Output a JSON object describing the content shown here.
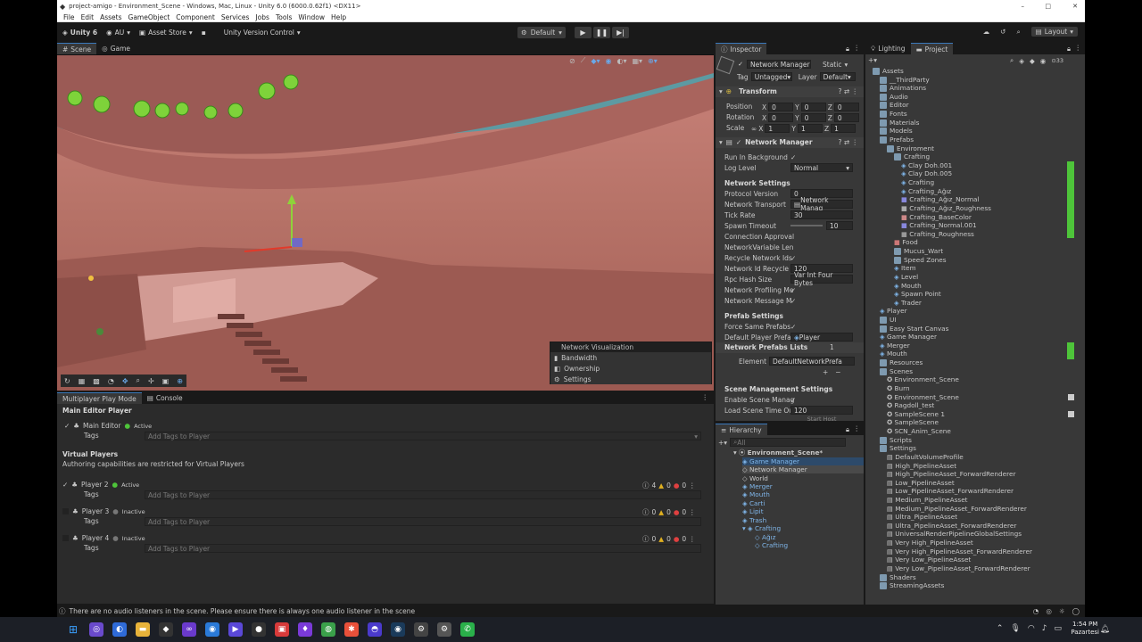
{
  "window": {
    "title": "project-amigo - Environment_Scene - Windows, Mac, Linux - Unity 6.0 (6000.0.62f1) <DX11>",
    "controls": [
      "–",
      "□",
      "✕"
    ]
  },
  "menu": [
    "File",
    "Edit",
    "Assets",
    "GameObject",
    "Component",
    "Services",
    "Jobs",
    "Tools",
    "Window",
    "Help"
  ],
  "toolbar": {
    "unity": "Unity 6",
    "account": "AU",
    "asset_store": "Asset Store",
    "version_control": "Unity Version Control",
    "play_mode": "Default",
    "layout": "Layout"
  },
  "scene_tabs": [
    "Scene",
    "Game"
  ],
  "network_overlay": {
    "title": "Network Visualization",
    "items": [
      "Bandwidth",
      "Ownership",
      "Settings"
    ]
  },
  "mppm": {
    "tabs": [
      "Multiplayer Play Mode",
      "Console"
    ],
    "main_editor": "Main Editor Player",
    "main_label": "Main Editor",
    "active": "Active",
    "inactive": "Inactive",
    "tags": "Tags",
    "tags_placeholder": "Add Tags to Player",
    "virtual": "Virtual Players",
    "virtual_note": "Authoring capabilities are restricted for Virtual Players",
    "players": [
      {
        "name": "Player 2",
        "state": "Active",
        "info": "4",
        "warn": "0",
        "err": "0"
      },
      {
        "name": "Player 3",
        "state": "Inactive",
        "info": "0",
        "warn": "0",
        "err": "0"
      },
      {
        "name": "Player 4",
        "state": "Inactive",
        "info": "0",
        "warn": "0",
        "err": "0"
      }
    ]
  },
  "inspector": {
    "tab": "Inspector",
    "object_name": "Network Manager",
    "static": "Static",
    "tag_label": "Tag",
    "tag": "Untagged",
    "layer_label": "Layer",
    "layer": "Default",
    "transform": "Transform",
    "position": "Position",
    "rotation": "Rotation",
    "scale": "Scale",
    "x": "X",
    "y": "Y",
    "z": "Z",
    "pos": [
      "0",
      "0",
      "0"
    ],
    "rot": [
      "0",
      "0",
      "0"
    ],
    "scl": [
      "1",
      "1",
      "1"
    ],
    "component": "Network Manager",
    "rows": [
      {
        "label": "Run In Background",
        "value": "✓"
      },
      {
        "label": "Log Level",
        "value": "Normal"
      }
    ],
    "network_settings": "Network Settings",
    "settings": [
      {
        "label": "Protocol Version",
        "value": "0"
      },
      {
        "label": "Network Transport",
        "value": "Network Manag"
      },
      {
        "label": "Tick Rate",
        "value": "30"
      },
      {
        "label": "Spawn Timeout",
        "value": "10"
      },
      {
        "label": "Connection Approval",
        "value": ""
      },
      {
        "label": "NetworkVariable Len",
        "value": ""
      },
      {
        "label": "Recycle Network Ids",
        "value": "✓"
      },
      {
        "label": "Network Id Recycle D",
        "value": "120"
      },
      {
        "label": "Rpc Hash Size",
        "value": "Var Int Four Bytes"
      },
      {
        "label": "Network Profiling Me",
        "value": "✓"
      },
      {
        "label": "Network Message M",
        "value": "✓"
      }
    ],
    "prefab_settings": "Prefab Settings",
    "force_same": "Force Same Prefabs",
    "default_player": "Default Player Prefab",
    "default_player_val": "Player",
    "prefab_lists": "Network Prefabs Lists",
    "prefab_count": "1",
    "element": "Element",
    "element_val": "DefaultNetworkPrefa",
    "scene_mgmt": "Scene Management Settings",
    "enable_scene": "Enable Scene Manag",
    "load_timeout": "Load Scene Time Ou",
    "load_timeout_val": "120",
    "start_host": "Start Host"
  },
  "hierarchy": {
    "tab": "Hierarchy",
    "search": "All",
    "scene": "Environment_Scene*",
    "items": [
      "Game Manager",
      "Network Manager",
      "World",
      "Merger",
      "Mouth",
      "Carti",
      "Lipit",
      "Trash",
      "Crafting",
      "Ağız",
      "Crafting"
    ]
  },
  "project": {
    "tabs": [
      "Lighting",
      "Project"
    ],
    "count": "33",
    "tree": [
      "Assets",
      "__ThirdParty",
      "Animations",
      "Audio",
      "Editor",
      "Fonts",
      "Materials",
      "Models",
      "Prefabs",
      "Enviroment",
      "Crafting",
      "Clay Doh.001",
      "Clay Doh.005",
      "Crafting",
      "Crafting_Ağız",
      "Crafting_Ağız_Normal",
      "Crafting_Ağız_Roughness",
      "Crafting_BaseColor",
      "Crafting_Normal.001",
      "Crafting_Roughness",
      "Food",
      "Mucus_Wart",
      "Speed Zones",
      "Item",
      "Level",
      "Mouth",
      "Spawn Point",
      "Trader",
      "Player",
      "UI",
      "Easy Start Canvas",
      "Game Manager",
      "Merger",
      "Mouth",
      "Resources",
      "Scenes",
      "Environment_Scene",
      "Burn",
      "Environment_Scene",
      "Ragdoll_test",
      "SampleScene 1",
      "SampleScene",
      "SCN_Anim_Scene",
      "Scripts",
      "Settings",
      "DefaultVolumeProfile",
      "High_PipelineAsset",
      "High_PipelineAsset_ForwardRenderer",
      "Low_PipelineAsset",
      "Low_PipelineAsset_ForwardRenderer",
      "Medium_PipelineAsset",
      "Medium_PipelineAsset_ForwardRenderer",
      "Ultra_PipelineAsset",
      "Ultra_PipelineAsset_ForwardRenderer",
      "UniversalRenderPipelineGlobalSettings",
      "Very High_PipelineAsset",
      "Very High_PipelineAsset_ForwardRenderer",
      "Very Low_PipelineAsset",
      "Very Low_PipelineAsset_ForwardRenderer",
      "Shaders",
      "StreamingAssets"
    ]
  },
  "status": "There are no audio listeners in the scene. Please ensure there is always one audio listener in the scene",
  "clock": {
    "time": "1:54 PM",
    "day": "Pazartesi"
  },
  "colors": {
    "accent": "#3a79bb",
    "panel": "#383838",
    "bg": "#191919",
    "green": "#4ec43a"
  }
}
